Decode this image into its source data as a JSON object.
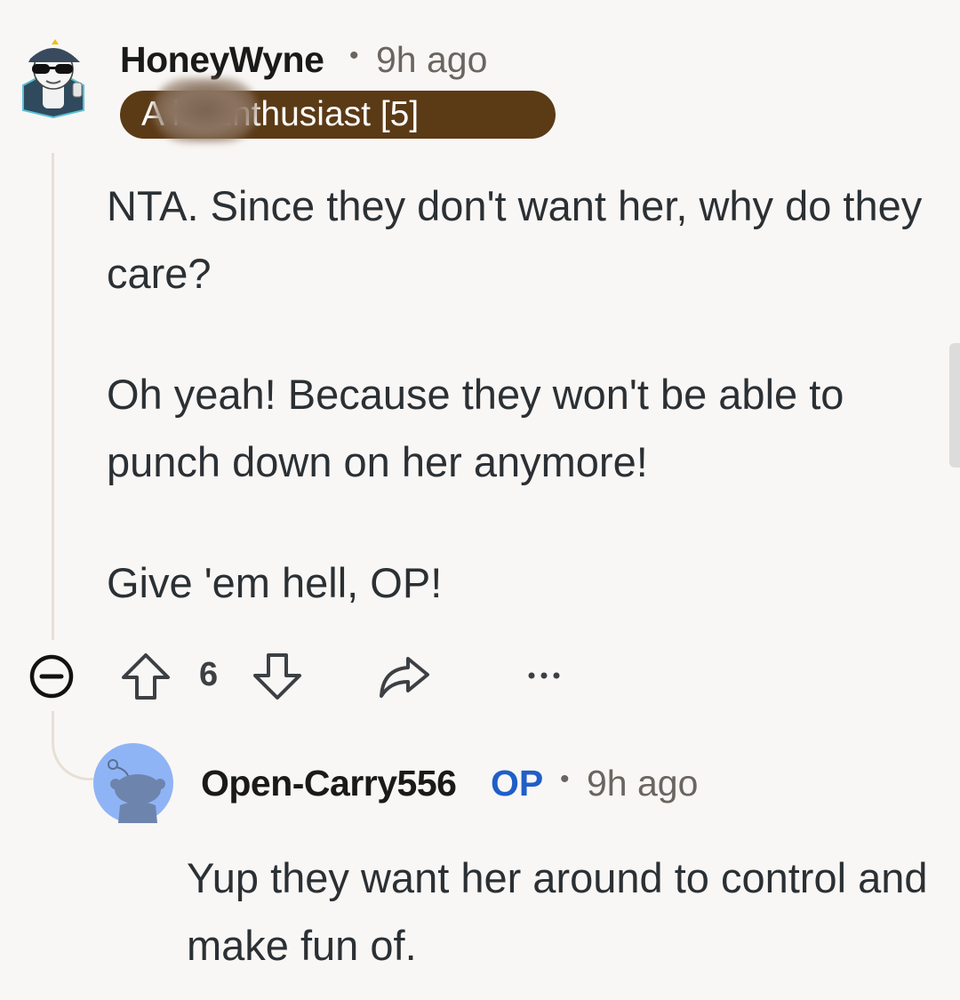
{
  "comment": {
    "username": "HoneyWyne",
    "separator": "•",
    "time": "9h ago",
    "flair": "A      le Enthusiast [5]",
    "paragraphs": [
      "NTA. Since they don't want her, why do they care?",
      "Oh yeah! Because they won't be able to punch down on her anymore!",
      "Give 'em hell, OP!"
    ],
    "actions": {
      "vote_count": "6",
      "collapse_icon": "collapse-minus-icon",
      "upvote_icon": "arrow-up-outline-icon",
      "downvote_icon": "arrow-down-outline-icon",
      "share_icon": "share-arrow-icon",
      "more_icon": "ellipsis-icon"
    }
  },
  "reply": {
    "username": "Open-Carry556",
    "op_badge": "OP",
    "separator": "•",
    "time": "9h ago",
    "body": "Yup they want her around to control and make fun of."
  },
  "colors": {
    "background": "#f9f7f5",
    "flair_bg": "#5b3a16",
    "op_blue": "#1f5fc8",
    "text": "#2b3034",
    "meta": "#6b6560",
    "thread_line": "#e8dfd7",
    "avatar2_bg": "#8fb4f5"
  }
}
